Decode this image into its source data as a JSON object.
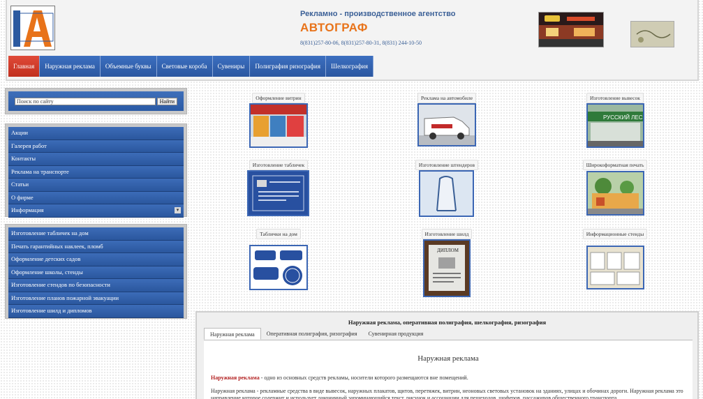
{
  "header": {
    "agency_name": "Рекламно - производственное агентство",
    "brand": "АВТОГРАФ",
    "phones": "8(831)257-80-06, 8(831)257-80-31, 8(831) 244-10-50"
  },
  "nav": {
    "items": [
      "Главная",
      "Наружная реклама",
      "Объемные буквы",
      "Световые короба",
      "Сувениры",
      "Полиграфия ризография",
      "Шелкография"
    ]
  },
  "search": {
    "placeholder": "Поиск по сайту",
    "button_label": "Найти"
  },
  "menu1": {
    "items": [
      "Акции",
      "Галерея работ",
      "Контакты",
      "Реклама на транспорте",
      "Статьи",
      "О фирме",
      "Информация"
    ]
  },
  "menu2": {
    "items": [
      "Изготовление табличек на дом",
      "Печать гарантийных наклеек, пломб",
      "Оформление детских садов",
      "Оформление школы, стенды",
      "Изготовление стендов по безопасности",
      "Изготовление планов пожарной эвакуации",
      "Изготовление шилд и дипломов"
    ]
  },
  "gallery": {
    "items": [
      {
        "label": "Оформление витрин"
      },
      {
        "label": "Реклама на автомобиле"
      },
      {
        "label": "Изготовление вывесок"
      },
      {
        "label": "Изготовление табличек"
      },
      {
        "label": "Изготовление штендеров"
      },
      {
        "label": "Широкоформатная печать"
      },
      {
        "label": "Таблички на дом"
      },
      {
        "label": "Изготовление шилд"
      },
      {
        "label": "Информационные стенды"
      }
    ],
    "thumb_text": {
      "shield_name": "РУССКИЙ ЛЕС",
      "diploma": "ДИПЛОМ"
    }
  },
  "content": {
    "title": "Наружная реклама, оперативная полиграфия, шелкография, ризография",
    "tabs": [
      "Наружная реклама",
      "Оперативная полиграфия, ризография",
      "Сувенирная продукция"
    ],
    "section_heading": "Наружная реклама",
    "para1_highlight": "Наружная реклама",
    "para1_rest": " - одно из основных средств рекламы, носители которого размещаются вне помещений.",
    "para2": "Наружная реклама - рекламные средства в виде вывесок, наружных плакатов, щитов, перетяжек, витрин, неоновых световых установок на зданиях, улицах и обочинах дороги. Наружная реклама это направление которое содержит и использует лаконичный запоминающийся текст, рисунок и ассоциации для пешеходов, шоферов, пассажиров общественного транспорта."
  },
  "colors": {
    "nav_blue": "#2b57a0",
    "nav_active": "#c1301f",
    "brand_orange": "#e8731a",
    "agency_blue": "#3a5f96",
    "thumb_border": "#3b66b4"
  }
}
